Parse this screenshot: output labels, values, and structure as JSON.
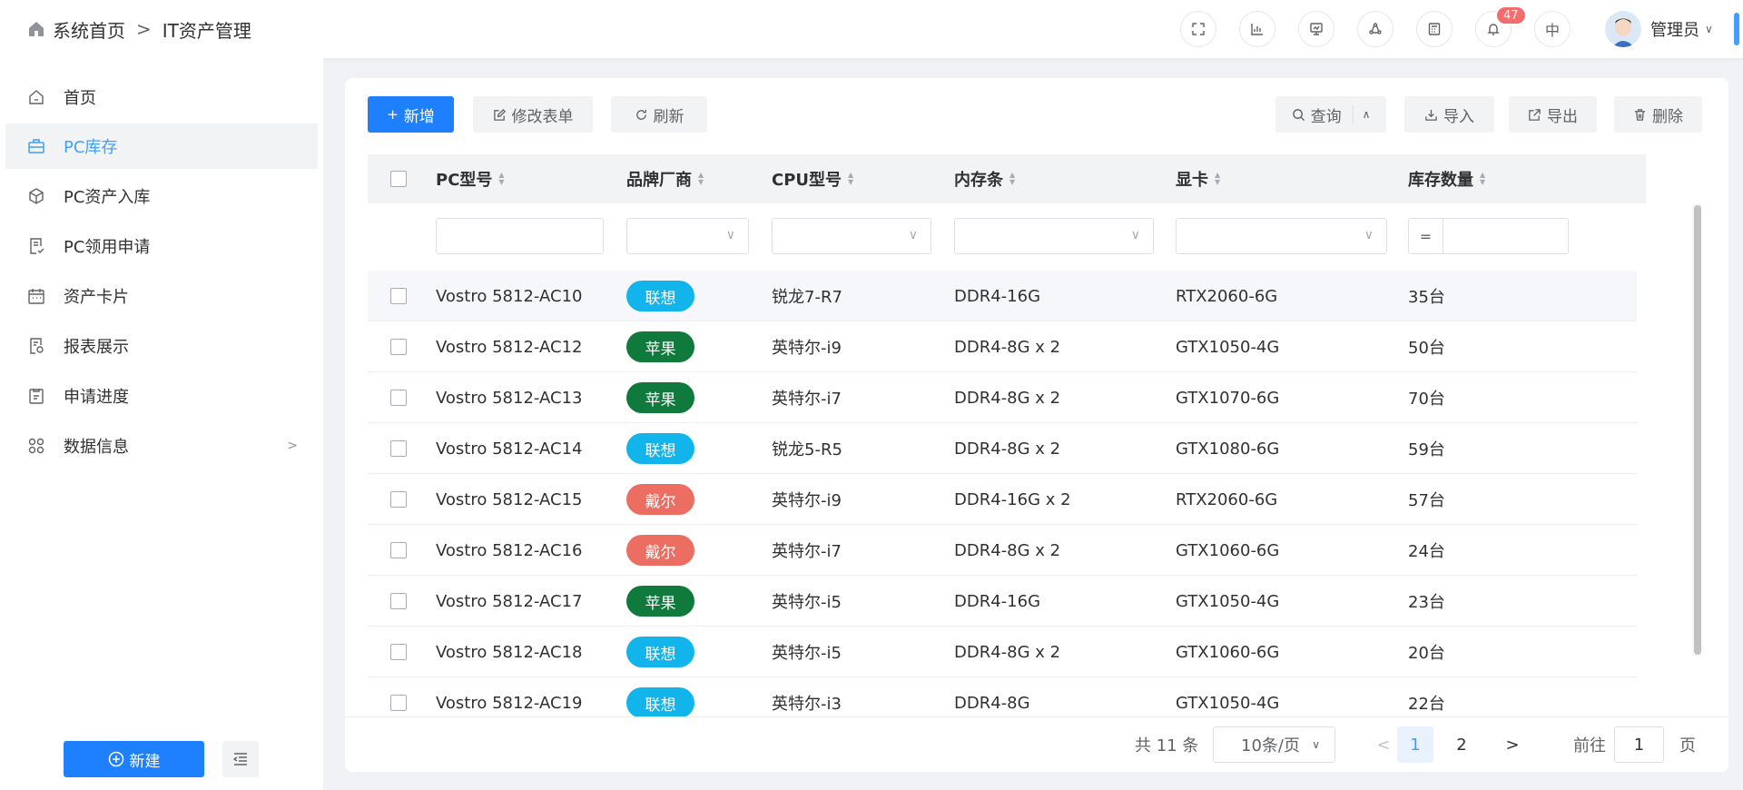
{
  "breadcrumb": {
    "home": "系统首页",
    "current": "IT资产管理"
  },
  "header": {
    "notification_count": "47",
    "language": "中",
    "user_name": "管理员"
  },
  "sidebar": {
    "items": [
      {
        "label": "首页"
      },
      {
        "label": "PC库存"
      },
      {
        "label": "PC资产入库"
      },
      {
        "label": "PC领用申请"
      },
      {
        "label": "资产卡片"
      },
      {
        "label": "报表展示"
      },
      {
        "label": "申请进度"
      },
      {
        "label": "数据信息"
      }
    ],
    "new_button": "新建"
  },
  "toolbar": {
    "add": "新增",
    "edit_form": "修改表单",
    "refresh": "刷新",
    "query": "查询",
    "import": "导入",
    "export": "导出",
    "delete": "删除"
  },
  "table": {
    "columns": [
      "PC型号",
      "品牌厂商",
      "CPU型号",
      "内存条",
      "显卡",
      "库存数量"
    ],
    "filter_eq": "=",
    "rows": [
      {
        "model": "Vostro 5812-AC10",
        "brand": "联想",
        "cpu": "锐龙7-R7",
        "memory": "DDR4-16G",
        "gpu": "RTX2060-6G",
        "stock": "35台"
      },
      {
        "model": "Vostro 5812-AC12",
        "brand": "苹果",
        "cpu": "英特尔-i9",
        "memory": "DDR4-8G x 2",
        "gpu": "GTX1050-4G",
        "stock": "50台"
      },
      {
        "model": "Vostro 5812-AC13",
        "brand": "苹果",
        "cpu": "英特尔-i7",
        "memory": "DDR4-8G x 2",
        "gpu": "GTX1070-6G",
        "stock": "70台"
      },
      {
        "model": "Vostro 5812-AC14",
        "brand": "联想",
        "cpu": "锐龙5-R5",
        "memory": "DDR4-8G x 2",
        "gpu": "GTX1080-6G",
        "stock": "59台"
      },
      {
        "model": "Vostro 5812-AC15",
        "brand": "戴尔",
        "cpu": "英特尔-i9",
        "memory": "DDR4-16G x 2",
        "gpu": "RTX2060-6G",
        "stock": "57台"
      },
      {
        "model": "Vostro 5812-AC16",
        "brand": "戴尔",
        "cpu": "英特尔-i7",
        "memory": "DDR4-8G x 2",
        "gpu": "GTX1060-6G",
        "stock": "24台"
      },
      {
        "model": "Vostro 5812-AC17",
        "brand": "苹果",
        "cpu": "英特尔-i5",
        "memory": "DDR4-16G",
        "gpu": "GTX1050-4G",
        "stock": "23台"
      },
      {
        "model": "Vostro 5812-AC18",
        "brand": "联想",
        "cpu": "英特尔-i5",
        "memory": "DDR4-8G x 2",
        "gpu": "GTX1060-6G",
        "stock": "20台"
      },
      {
        "model": "Vostro 5812-AC19",
        "brand": "联想",
        "cpu": "英特尔-i3",
        "memory": "DDR4-8G",
        "gpu": "GTX1050-4G",
        "stock": "22台"
      }
    ]
  },
  "brand_colors": {
    "联想": "#11b5ec",
    "苹果": "#0f7a3c",
    "戴尔": "#ec6e63"
  },
  "pagination": {
    "total": "共 11 条",
    "page_size": "10条/页",
    "pages": [
      "1",
      "2"
    ],
    "goto_label": "前往",
    "goto_value": "1",
    "page_suffix": "页"
  }
}
